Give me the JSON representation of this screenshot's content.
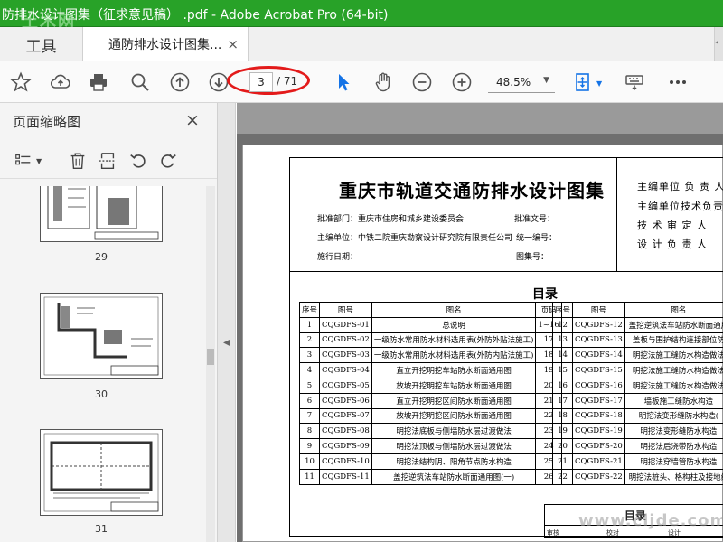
{
  "window": {
    "title": "防排水设计图集（征求意见稿） .pdf - Adobe Acrobat Pro (64-bit)",
    "watermark_top": "土木网",
    "watermark_bottom": "www.cljde.com"
  },
  "tabs": {
    "tools_label": "工具",
    "doc_label": "通防排水设计图集...",
    "doc_close": "×"
  },
  "toolbar": {
    "current_page": "3",
    "total_pages": "/ 71",
    "zoom": "48.5%",
    "accent": "#1473e6",
    "highlight": "#e31a1a"
  },
  "sidebar": {
    "title": "页面缩略图",
    "close": "×",
    "thumbnails": [
      {
        "label": "29"
      },
      {
        "label": "30"
      },
      {
        "label": "31"
      }
    ]
  },
  "document": {
    "title": "重庆市轨道交通防排水设计图集",
    "approval_dept": "批准部门：重庆市住房和城乡建设委员会",
    "approval_no": "批准文号：",
    "editor_unit": "主编单位：中铁二院重庆勘察设计研究院有限责任公司",
    "unified_no": "统一编号：",
    "impl_date": "施行日期：",
    "atlas_no": "图集号：",
    "roles": [
      "主编单位 负 责 人",
      "主编单位技术负责人",
      "技 术 审 定 人",
      "设 计 负 责 人"
    ],
    "toc_title": "目录",
    "toc_headers": [
      "序号",
      "图号",
      "图名",
      "页码"
    ],
    "toc_left": [
      [
        "1",
        "CQGDFS-01",
        "总说明",
        "1~16"
      ],
      [
        "2",
        "CQGDFS-02",
        "一级防水常用防水材料选用表(外防外贴法施工)",
        "17"
      ],
      [
        "3",
        "CQGDFS-03",
        "一级防水常用防水材料选用表(外防内贴法施工)",
        "18"
      ],
      [
        "4",
        "CQGDFS-04",
        "直立开挖明挖车站防水断面通用图",
        "19"
      ],
      [
        "5",
        "CQGDFS-05",
        "放坡开挖明挖车站防水断面通用图",
        "20"
      ],
      [
        "6",
        "CQGDFS-06",
        "直立开挖明挖区间防水断面通用图",
        "21"
      ],
      [
        "7",
        "CQGDFS-07",
        "放坡开挖明挖区间防水断面通用图",
        "22"
      ],
      [
        "8",
        "CQGDFS-08",
        "明挖法底板与侧墙防水层过渡做法",
        "23"
      ],
      [
        "9",
        "CQGDFS-09",
        "明挖法顶板与侧墙防水层过渡做法",
        "24"
      ],
      [
        "10",
        "CQGDFS-10",
        "明挖法结构阴、阳角节点防水构造",
        "25"
      ],
      [
        "11",
        "CQGDFS-11",
        "盖挖逆筑法车站防水断面通用图(一)",
        "26"
      ]
    ],
    "toc_right": [
      [
        "12",
        "CQGDFS-12",
        "盖挖逆筑法车站防水断面通用"
      ],
      [
        "13",
        "CQGDFS-13",
        "盖板与围护结构连接部位防"
      ],
      [
        "14",
        "CQGDFS-14",
        "明挖法施工缝防水构造做法"
      ],
      [
        "15",
        "CQGDFS-15",
        "明挖法施工缝防水构造做法"
      ],
      [
        "16",
        "CQGDFS-16",
        "明挖法施工缝防水构造做法"
      ],
      [
        "17",
        "CQGDFS-17",
        "墙板施工缝防水构造"
      ],
      [
        "18",
        "CQGDFS-18",
        "明挖法变形缝防水构造("
      ],
      [
        "19",
        "CQGDFS-19",
        "明挖法变形缝防水构造"
      ],
      [
        "20",
        "CQGDFS-20",
        "明挖法后浇带防水构造"
      ],
      [
        "21",
        "CQGDFS-21",
        "明挖法穿墙管防水构造"
      ],
      [
        "22",
        "CQGDFS-22",
        "明挖法桩头、格构柱及接地线"
      ]
    ],
    "bottom_title": "目录",
    "bottom_row": [
      "审核",
      "校对",
      "设计"
    ]
  }
}
